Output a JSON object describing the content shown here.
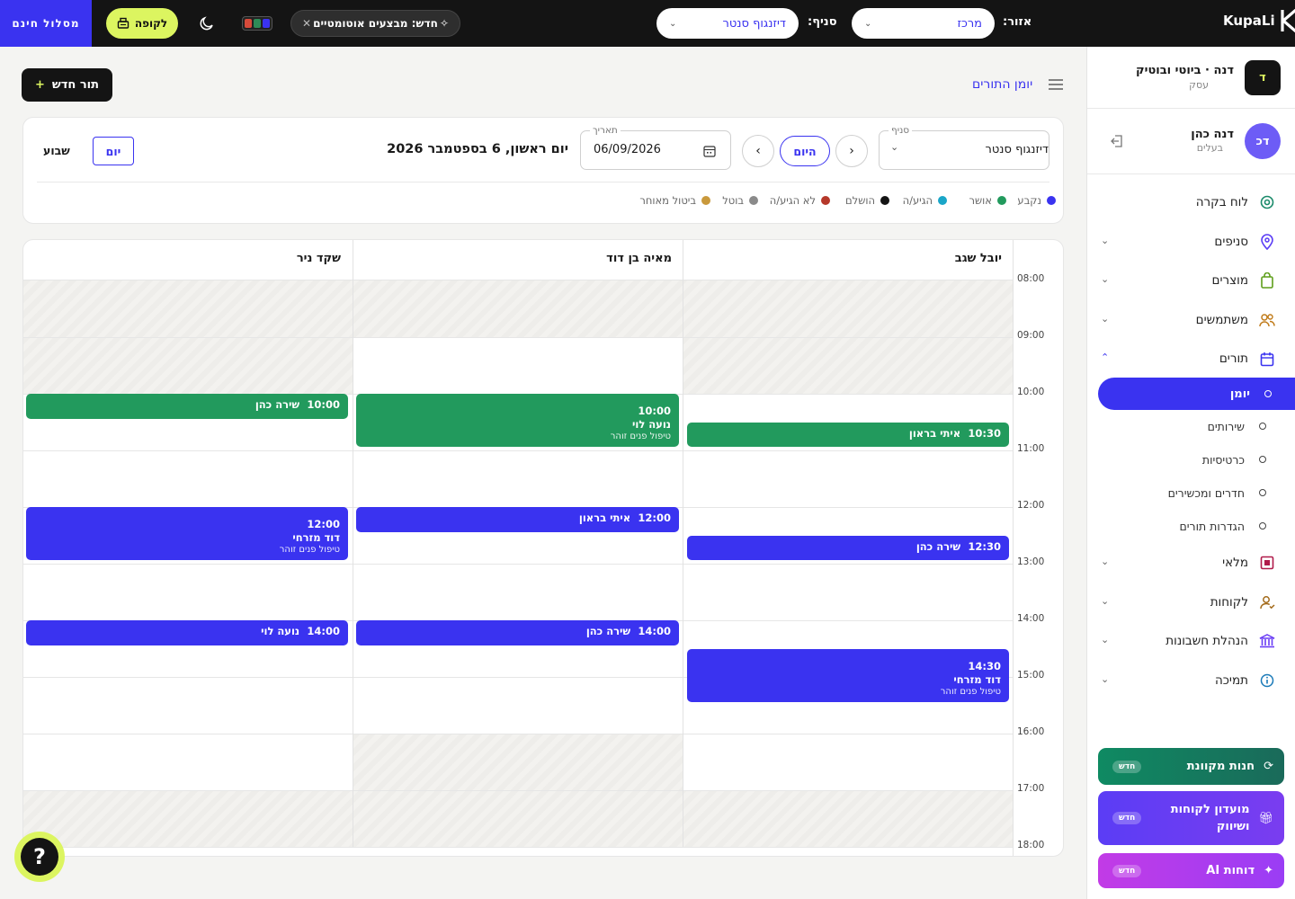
{
  "topbar": {
    "promo_label": "מסלול חינם",
    "checkout_label": "לקופה",
    "new_feature_label": "חדש: מבצעים אוטומטיים",
    "branch_label": "סניף:",
    "branch_value": "דיזנגוף סנטר",
    "area_label": "אזור:",
    "area_value": "מרכז",
    "logo_text": "KupaLi",
    "palette_colors": [
      "#d64a3a",
      "#2e8b57",
      "#3a33f0"
    ]
  },
  "sidebar": {
    "business_initial": "ד",
    "business_name": "דנה · ביוטי ובוטיק",
    "business_role": "עסק",
    "user_initials": "דכ",
    "user_name": "דנה כהן",
    "user_role": "בעלים",
    "nav": [
      {
        "label": "לוח בקרה",
        "icon": "dashboard-icon"
      },
      {
        "label": "סניפים",
        "icon": "location-pin-icon"
      },
      {
        "label": "מוצרים",
        "icon": "shopping-bag-icon"
      },
      {
        "label": "משתמשים",
        "icon": "users-icon"
      },
      {
        "label": "תורים",
        "icon": "calendar-icon"
      },
      {
        "label": "מלאי",
        "icon": "inventory-icon"
      },
      {
        "label": "לקוחות",
        "icon": "customers-icon"
      },
      {
        "label": "הנהלת חשבונות",
        "icon": "bank-icon"
      },
      {
        "label": "תמיכה",
        "icon": "info-icon"
      }
    ],
    "sub_items": [
      "יומן",
      "שירותים",
      "כרטיסיות",
      "חדרים ומכשירים",
      "הגדרות תורים"
    ],
    "promos": [
      {
        "label": "חנות מקוונת",
        "badge": "חדש",
        "color": "#1a8a6a"
      },
      {
        "label": "מועדון לקוחות ושיווק",
        "badge": "חדש",
        "color": "#5b3df5"
      },
      {
        "label": "דוחות AI",
        "badge": "חדש",
        "color": "#b63ee8"
      }
    ]
  },
  "header": {
    "new_appointment_label": "תור חדש",
    "breadcrumb": "יומן התורים"
  },
  "filters": {
    "branch_field_label": "סניף",
    "branch_value": "דיזנגוף סנטר",
    "date_field_label": "תאריך",
    "date_value": "06/09/2026",
    "today_label": "היום",
    "date_title": "יום ראשון, 6 בספטמבר 2026",
    "day_label": "יום",
    "week_label": "שבוע"
  },
  "legend": [
    {
      "label": "נקבע",
      "color": "#3a33f0"
    },
    {
      "label": "אושר",
      "color": "#229a5d"
    },
    {
      "label": "הגיע/ה",
      "color": "#1aa6c8"
    },
    {
      "label": "הושלם",
      "color": "#141414"
    },
    {
      "label": "לא הגיע/ה",
      "color": "#b5382a"
    },
    {
      "label": "בוטל",
      "color": "#8a8a8a"
    },
    {
      "label": "ביטול מאוחר",
      "color": "#c9993c"
    }
  ],
  "calendar": {
    "staff": [
      "יובל שגב",
      "מאיה בן דוד",
      "שקד ניר"
    ],
    "hours": [
      "08:00",
      "09:00",
      "10:00",
      "11:00",
      "12:00",
      "13:00",
      "14:00",
      "15:00",
      "16:00",
      "17:00",
      "18:00"
    ],
    "appointments": [
      {
        "col": 0,
        "start": "10:30",
        "end": "11:00",
        "time": "10:30",
        "client": "איתי בראון",
        "service": "",
        "status": "אושר"
      },
      {
        "col": 0,
        "start": "12:30",
        "end": "13:00",
        "time": "12:30",
        "client": "שירה כהן",
        "service": "",
        "status": "נקבע"
      },
      {
        "col": 0,
        "start": "14:30",
        "end": "15:30",
        "time": "14:30",
        "client": "דוד מזרחי",
        "service": "טיפול פנים זוהר",
        "status": "נקבע"
      },
      {
        "col": 1,
        "start": "10:00",
        "end": "11:00",
        "time": "10:00",
        "client": "נועה לוי",
        "service": "טיפול פנים זוהר",
        "status": "אושר"
      },
      {
        "col": 1,
        "start": "12:00",
        "end": "12:30",
        "time": "12:00",
        "client": "איתי בראון",
        "service": "",
        "status": "נקבע"
      },
      {
        "col": 1,
        "start": "14:00",
        "end": "14:30",
        "time": "14:00",
        "client": "שירה כהן",
        "service": "",
        "status": "נקבע"
      },
      {
        "col": 2,
        "start": "10:00",
        "end": "10:30",
        "time": "10:00",
        "client": "שירה כהן",
        "service": "",
        "status": "אושר"
      },
      {
        "col": 2,
        "start": "12:00",
        "end": "13:00",
        "time": "12:00",
        "client": "דוד מזרחי",
        "service": "טיפול פנים זוהר",
        "status": "נקבע"
      },
      {
        "col": 2,
        "start": "14:00",
        "end": "14:30",
        "time": "14:00",
        "client": "נועה לוי",
        "service": "",
        "status": "נקבע"
      }
    ]
  }
}
